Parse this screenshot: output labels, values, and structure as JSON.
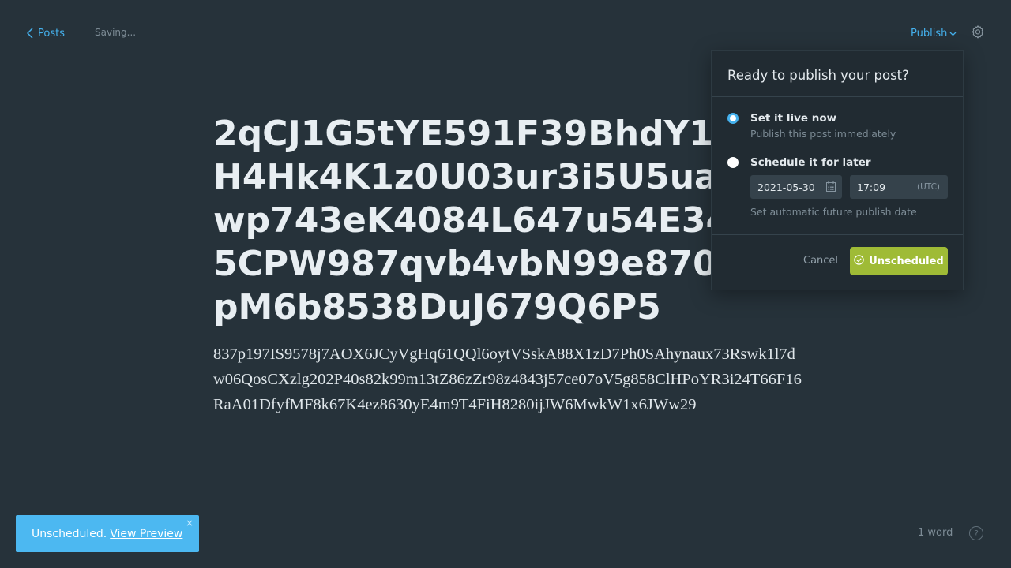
{
  "header": {
    "back_label": "Posts",
    "save_status": "Saving...",
    "publish_label": "Publish"
  },
  "post": {
    "title_lines": [
      "2qCJ1G5tYE591F39BhdY1Q",
      "H4Hk4K1z0U03ur3i5U5uaJ1",
      "wp743eK4084L647u54E346l",
      "5CPW987qvb4vbN99e870lh",
      "pM6b8538DuJ679Q6P5"
    ],
    "body_lines": [
      "837p197IS9578j7AOX6JCyVgHq61QQl6oytVSskA88X1zD7Ph0SAhynaux73Rswk1l7d",
      "w06QosCXzlg202P40s82k99m13tZ86zZr98z4843j57ce07oV5g858ClHPoYR3i24T66F16",
      "RaA01DfyfMF8k67K4ez8630yE4m9T4FiH8280ijJW6MwkW1x6JWw29"
    ]
  },
  "publish_menu": {
    "title": "Ready to publish your post?",
    "options": [
      {
        "label": "Set it live now",
        "description": "Publish this post immediately",
        "selected": true
      },
      {
        "label": "Schedule it for later",
        "description": "Set automatic future publish date",
        "selected": false
      }
    ],
    "date_value": "2021-05-30",
    "time_value": "17:09",
    "timezone": "(UTC)",
    "cancel_label": "Cancel",
    "primary_label": "Unscheduled"
  },
  "toast": {
    "message": "Unscheduled.",
    "link_label": "View Preview",
    "close_symbol": "×"
  },
  "footer": {
    "word_count": "1 word",
    "help_symbol": "?"
  },
  "colors": {
    "accent": "#45b1ed",
    "primary_button": "#9fbb36",
    "toast": "#4cb8f1",
    "background": "#26323a"
  }
}
